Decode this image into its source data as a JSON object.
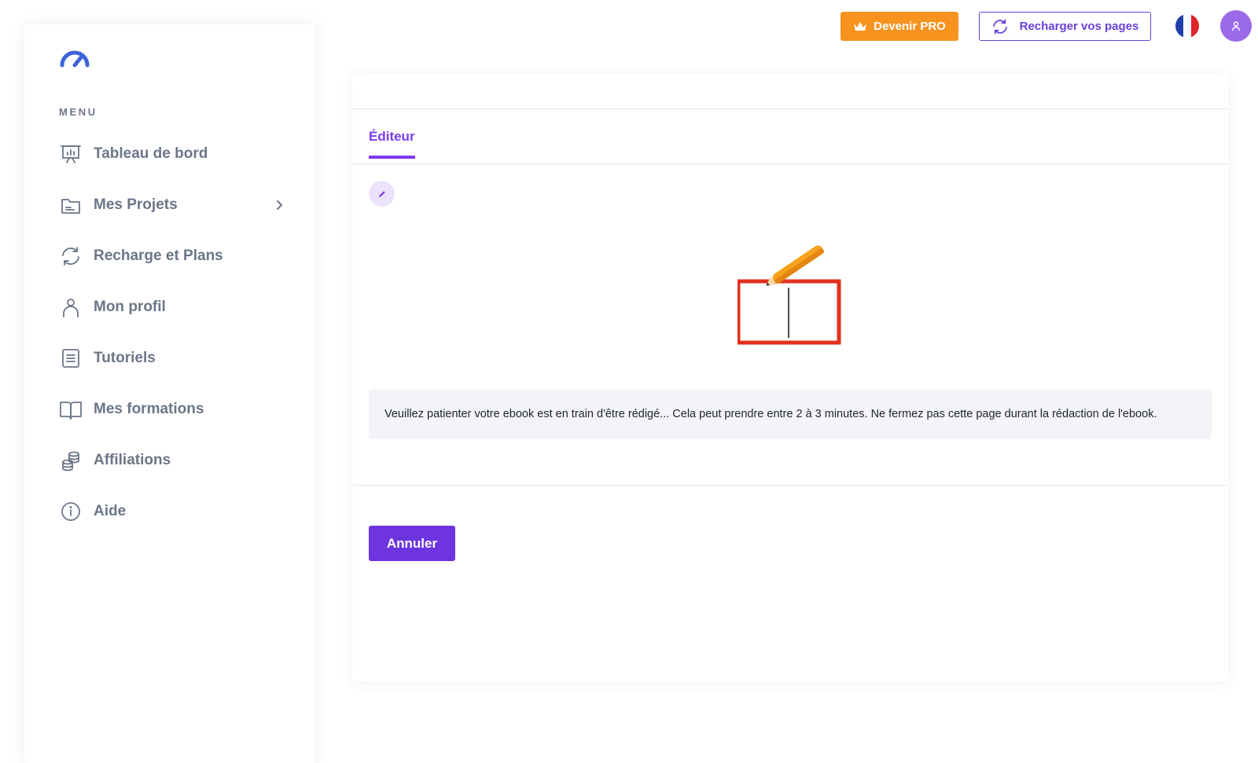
{
  "topbar": {
    "pro_label": "Devenir PRO",
    "reload_label": "Recharger vos pages",
    "language_flag": "flag-france-icon",
    "colors": {
      "pro": "#f7931e",
      "accent": "#6a3fd8",
      "avatar": "#9b6ae8"
    }
  },
  "sidebar": {
    "menu_heading": "MENU",
    "items": [
      {
        "label": "Tableau de bord",
        "icon": "presentation-chart-icon"
      },
      {
        "label": "Mes Projets",
        "icon": "folder-icon",
        "has_submenu": true
      },
      {
        "label": "Recharge et Plans",
        "icon": "refresh-icon"
      },
      {
        "label": "Mon profil",
        "icon": "user-icon"
      },
      {
        "label": "Tutoriels",
        "icon": "document-list-icon"
      },
      {
        "label": "Mes formations",
        "icon": "open-book-icon"
      },
      {
        "label": "Affiliations",
        "icon": "coins-icon"
      },
      {
        "label": "Aide",
        "icon": "info-icon"
      }
    ]
  },
  "main": {
    "tabs": [
      {
        "label": "Éditeur",
        "active": true
      }
    ],
    "notice": "Veuillez patienter votre ebook est en train d'être rédigé... Cela peut prendre entre 2 à 3 minutes. Ne fermez pas cette page durant la rédaction de l'ebook.",
    "cancel_label": "Annuler"
  }
}
